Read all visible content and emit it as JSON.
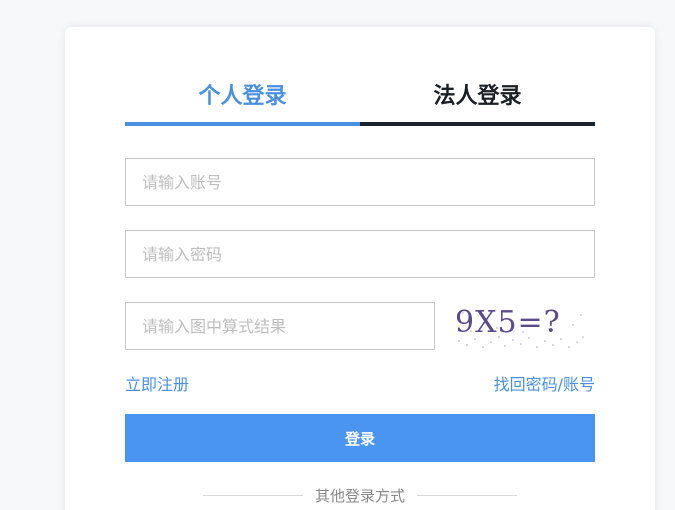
{
  "tabs": [
    {
      "label": "个人登录",
      "active": true
    },
    {
      "label": "法人登录",
      "active": false
    }
  ],
  "form": {
    "account_placeholder": "请输入账号",
    "password_placeholder": "请输入密码",
    "captcha_placeholder": "请输入图中算式结果",
    "captcha_text": "9X5=?"
  },
  "links": {
    "register": "立即注册",
    "recover": "找回密码/账号"
  },
  "login_button": "登录",
  "other_login": "其他登录方式",
  "colors": {
    "accent": "#4a90e2",
    "button": "#4a94f2",
    "inactive_tab": "#1b242c"
  }
}
